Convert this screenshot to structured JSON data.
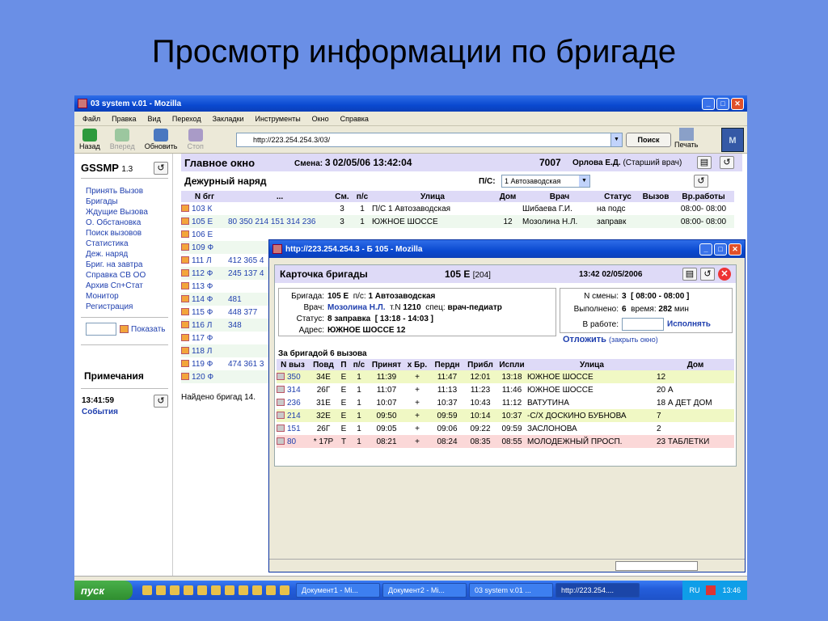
{
  "slide": {
    "title": "Просмотр информации по бригаде"
  },
  "browser": {
    "title": "03 system v.01 - Mozilla",
    "menu": [
      "Файл",
      "Правка",
      "Вид",
      "Переход",
      "Закладки",
      "Инструменты",
      "Окно",
      "Справка"
    ],
    "toolbar": {
      "back": "Назад",
      "forward": "Вперед",
      "reload": "Обновить",
      "stop": "Стоп",
      "search": "Поиск",
      "print": "Печать"
    },
    "url": "http://223.254.254.3/03/"
  },
  "left": {
    "app": "GSSMP",
    "version": "1.3",
    "nav": [
      "Принять Вызов",
      "Бригады",
      "Ждущие Вызова",
      "О. Обстановка",
      "Поиск вызовов",
      "Статистика",
      "Деж. наряд",
      "Бриг. на завтра",
      "Справка СВ ОО",
      "Архив Сп+Стат",
      "Монитор",
      "Регистрация"
    ],
    "show_label": "Показать",
    "notes_title": "Примечания",
    "time": "13:41:59",
    "events": "События"
  },
  "main": {
    "title": "Главное окно",
    "shift_label": "Смена:",
    "shift_num": "3",
    "date_time": "02/05/06  13:42:04",
    "code": "7007",
    "doctor": "Орлова Е.Д.",
    "doctor_role": "(Старший врач)",
    "duty_title": "Дежурный наряд",
    "ps_label": "П/С:",
    "ps_value": "1 Автозаводская",
    "columns": [
      "N бrг",
      "...",
      "См.",
      "п/с",
      "Улица",
      "Дом",
      "Врач",
      "Статус",
      "Вызов",
      "Вр.работы"
    ],
    "rows": [
      {
        "id": "103 К",
        "extra": "",
        "sm": "3",
        "ps": "1",
        "street": "П/С 1 Автозаводская",
        "house": "",
        "doctor": "Шибаева Г.И.",
        "status": "на подс",
        "call": "",
        "hours": "08:00- 08:00"
      },
      {
        "id": "105 Е",
        "extra": "80 350 214 151 314 236",
        "sm": "3",
        "ps": "1",
        "street": "ЮЖНОЕ ШОССЕ",
        "house": "12",
        "doctor": "Мозолина Н.Л.",
        "status": "заправк",
        "call": "",
        "hours": "08:00- 08:00"
      },
      {
        "id": "106 Е",
        "extra": "",
        "sm": "",
        "ps": "",
        "street": "",
        "house": "",
        "doctor": "",
        "status": "",
        "call": "",
        "hours": ""
      },
      {
        "id": "109 Ф",
        "extra": "",
        "sm": "",
        "ps": "",
        "street": "",
        "house": "",
        "doctor": "",
        "status": "",
        "call": "",
        "hours": ""
      },
      {
        "id": "111 Л",
        "extra": "412 365 4",
        "sm": "",
        "ps": "",
        "street": "",
        "house": "",
        "doctor": "",
        "status": "",
        "call": "",
        "hours": ""
      },
      {
        "id": "112 Ф",
        "extra": "245 137 4",
        "sm": "",
        "ps": "",
        "street": "",
        "house": "",
        "doctor": "",
        "status": "",
        "call": "",
        "hours": ""
      },
      {
        "id": "113 Ф",
        "extra": "",
        "sm": "",
        "ps": "",
        "street": "",
        "house": "",
        "doctor": "",
        "status": "",
        "call": "",
        "hours": ""
      },
      {
        "id": "114 Ф",
        "extra": "481",
        "sm": "",
        "ps": "",
        "street": "",
        "house": "",
        "doctor": "",
        "status": "",
        "call": "",
        "hours": ""
      },
      {
        "id": "115 Ф",
        "extra": "448 377",
        "sm": "",
        "ps": "",
        "street": "",
        "house": "",
        "doctor": "",
        "status": "",
        "call": "",
        "hours": ""
      },
      {
        "id": "116 Л",
        "extra": "348",
        "sm": "",
        "ps": "",
        "street": "",
        "house": "",
        "doctor": "",
        "status": "",
        "call": "",
        "hours": ""
      },
      {
        "id": "117 Ф",
        "extra": "",
        "sm": "",
        "ps": "",
        "street": "",
        "house": "",
        "doctor": "",
        "status": "",
        "call": "",
        "hours": ""
      },
      {
        "id": "118 Л",
        "extra": "",
        "sm": "",
        "ps": "",
        "street": "",
        "house": "",
        "doctor": "",
        "status": "",
        "call": "",
        "hours": ""
      },
      {
        "id": "119 Ф",
        "extra": "474 361 3",
        "sm": "",
        "ps": "",
        "street": "",
        "house": "",
        "doctor": "",
        "status": "",
        "call": "",
        "hours": ""
      },
      {
        "id": "120 Ф",
        "extra": "",
        "sm": "",
        "ps": "",
        "street": "",
        "house": "",
        "doctor": "",
        "status": "",
        "call": "",
        "hours": ""
      }
    ],
    "found": "Найдено бригад 14."
  },
  "popup": {
    "title": "http://223.254.254.3 - Б 105 - Mozilla",
    "card_title": "Карточка бригады",
    "brigade_num": "105 Е",
    "brigade_code": "[204]",
    "datetime": "13:42 02/05/2006",
    "info": {
      "brigade_label": "Бригада:",
      "brigade": "105 Е",
      "ps_label": "п/с:",
      "ps": "1 Автозаводская",
      "doctor_label": "Врач:",
      "doctor": "Мозолина Н.Л.",
      "tn_label": "т.N",
      "tn": "1210",
      "spec_label": "спец:",
      "spec": "врач-педиатр",
      "status_label": "Статус:",
      "status": "8 заправка",
      "status_time": "[ 13:18 - 14:03 ]",
      "address_label": "Адрес:",
      "address": "ЮЖНОЕ ШОССЕ 12"
    },
    "shift": {
      "shift_label": "N смены:",
      "shift": "3",
      "shift_hours": "[ 08:00 - 08:00 ]",
      "done_label": "Выполнено:",
      "done": "6",
      "time_label": "время:",
      "time": "282",
      "time_unit": "мин",
      "work_label": "В работе:",
      "execute": "Исполнять"
    },
    "postpone": "Отложить",
    "postpone_hint": "(закрыть окно)",
    "calls_title": "За бригадой 6 вызова",
    "columns": [
      "N выз",
      "Повд",
      "П",
      "п/с",
      "Принят",
      "х Бр.",
      "Пердн",
      "Прибл",
      "Испли",
      "Улица",
      "Дом"
    ],
    "calls": [
      {
        "n": "350",
        "povd": "34Е",
        "p": "Е",
        "ps": "1",
        "prinyat": "11:39",
        "xbr": "+",
        "perdn": "11:47",
        "pribl": "12:01",
        "ispl": "13:18",
        "street": "ЮЖНОЕ ШОССЕ",
        "house": "12"
      },
      {
        "n": "314",
        "povd": "26Г",
        "p": "Е",
        "ps": "1",
        "prinyat": "11:07",
        "xbr": "+",
        "perdn": "11:13",
        "pribl": "11:23",
        "ispl": "11:46",
        "street": "ЮЖНОЕ ШОССЕ",
        "house": "20 А"
      },
      {
        "n": "236",
        "povd": "31Е",
        "p": "Е",
        "ps": "1",
        "prinyat": "10:07",
        "xbr": "+",
        "perdn": "10:37",
        "pribl": "10:43",
        "ispl": "11:12",
        "street": "ВАТУТИНА",
        "house": "18 А ДЕТ ДОМ"
      },
      {
        "n": "214",
        "povd": "32Е",
        "p": "Е",
        "ps": "1",
        "prinyat": "09:50",
        "xbr": "+",
        "perdn": "09:59",
        "pribl": "10:14",
        "ispl": "10:37",
        "street": "-С/Х ДОСКИНО БУБНОВА",
        "house": "7"
      },
      {
        "n": "151",
        "povd": "26Г",
        "p": "Е",
        "ps": "1",
        "prinyat": "09:05",
        "xbr": "+",
        "perdn": "09:06",
        "pribl": "09:22",
        "ispl": "09:59",
        "street": "ЗАСЛОНОВА",
        "house": "2"
      },
      {
        "n": "80",
        "povd": "* 17Р",
        "p": "Т",
        "ps": "1",
        "prinyat": "08:21",
        "xbr": "+",
        "perdn": "08:24",
        "pribl": "08:35",
        "ispl": "08:55",
        "street": "МОЛОДЕЖНЫЙ ПРОСП.",
        "house": "23 ТАБЛЕТКИ"
      }
    ]
  },
  "taskbar": {
    "start": "пуск",
    "tasks": [
      "Документ1 - Mi...",
      "Документ2 - Mi...",
      "03 system v.01 ...",
      "http://223.254...."
    ],
    "lang": "RU",
    "clock": "13:46"
  }
}
